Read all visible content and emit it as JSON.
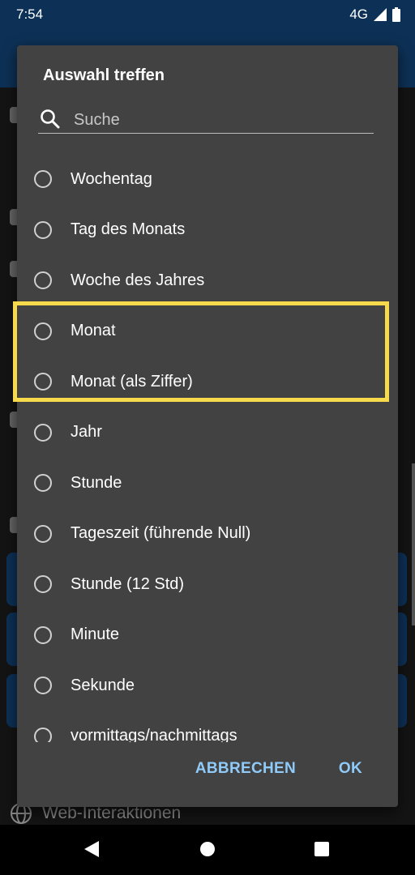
{
  "status_bar": {
    "time": "7:54",
    "network": "4G"
  },
  "background": {
    "peek_label": "Web-Interaktionen"
  },
  "dialog": {
    "title": "Auswahl treffen",
    "search_placeholder": "Suche",
    "options": [
      {
        "label": "Wochentag"
      },
      {
        "label": "Tag des Monats"
      },
      {
        "label": "Woche des Jahres"
      },
      {
        "label": "Monat"
      },
      {
        "label": "Monat (als Ziffer)"
      },
      {
        "label": "Jahr"
      },
      {
        "label": "Stunde"
      },
      {
        "label": "Tageszeit (führende Null)"
      },
      {
        "label": "Stunde (12 Std)"
      },
      {
        "label": "Minute"
      },
      {
        "label": "Sekunde"
      },
      {
        "label": "vormittags/nachmittags"
      }
    ],
    "cancel_label": "ABBRECHEN",
    "ok_label": "OK"
  },
  "colors": {
    "appbar": "#0d3156",
    "dialog_bg": "#424242",
    "accent_button": "#90caf9",
    "highlight_box": "#f7d94c"
  }
}
